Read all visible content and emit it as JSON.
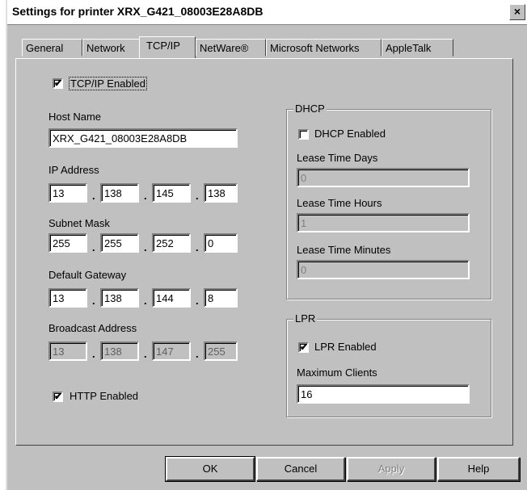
{
  "window": {
    "title": "Settings for printer XRX_G421_08003E28A8DB",
    "close_label": "×"
  },
  "tabs": [
    "General",
    "Network",
    "TCP/IP",
    "NetWare®",
    "Microsoft Networks",
    "AppleTalk"
  ],
  "tcpip": {
    "enabled_label": "TCP/IP Enabled",
    "enabled": true,
    "host_name_label": "Host Name",
    "host_name": "XRX_G421_08003E28A8DB",
    "ip_label": "IP Address",
    "ip": [
      "13",
      "138",
      "145",
      "138"
    ],
    "subnet_label": "Subnet Mask",
    "subnet": [
      "255",
      "255",
      "252",
      "0"
    ],
    "gateway_label": "Default Gateway",
    "gateway": [
      "13",
      "138",
      "144",
      "8"
    ],
    "broadcast_label": "Broadcast Address",
    "broadcast": [
      "13",
      "138",
      "147",
      "255"
    ],
    "http_label": "HTTP Enabled",
    "http_enabled": true,
    "dot": "."
  },
  "dhcp": {
    "group_label": "DHCP",
    "enabled_label": "DHCP Enabled",
    "enabled": false,
    "lease_days_label": "Lease Time Days",
    "lease_days": "0",
    "lease_hours_label": "Lease Time Hours",
    "lease_hours": "1",
    "lease_minutes_label": "Lease Time Minutes",
    "lease_minutes": "0"
  },
  "lpr": {
    "group_label": "LPR",
    "enabled_label": "LPR Enabled",
    "enabled": true,
    "max_clients_label": "Maximum Clients",
    "max_clients": "16"
  },
  "buttons": {
    "ok": "OK",
    "cancel": "Cancel",
    "apply": "Apply",
    "help": "Help"
  },
  "checkmark": "✔"
}
